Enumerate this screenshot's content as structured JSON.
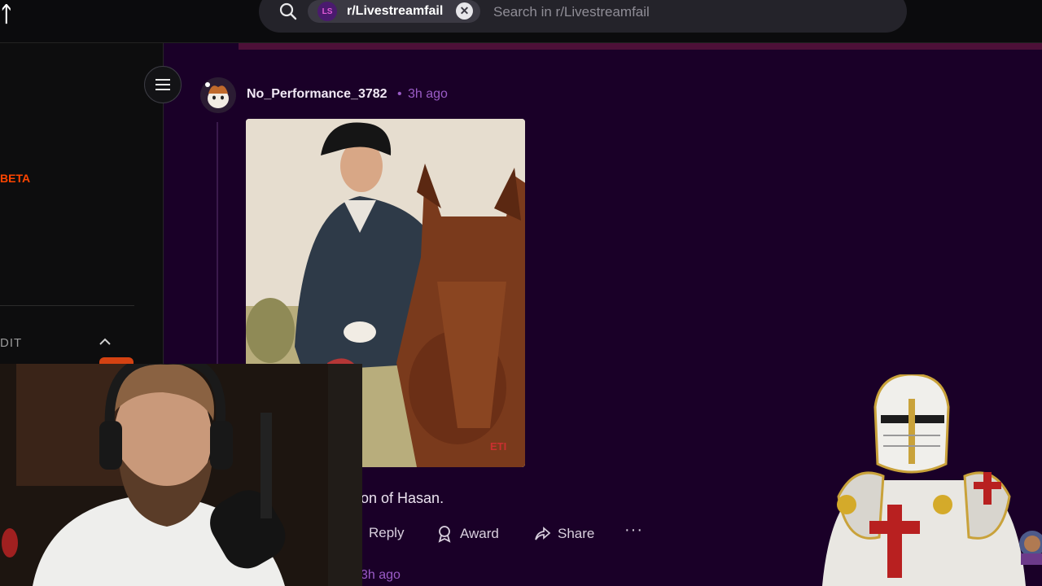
{
  "search": {
    "chip_label": "r/Livestreamfail",
    "chip_avatar_text": "LS",
    "placeholder": "Search in r/Livestreamfail",
    "clear_icon": "close-icon"
  },
  "sidebar": {
    "beta_label": "BETA",
    "section_label": "DIT",
    "menu_icon": "hamburger-icon"
  },
  "comment": {
    "username": "No_Performance_3782",
    "separator": "•",
    "time": "3h ago",
    "text": "on of Hasan.",
    "actions": {
      "reply": "Reply",
      "award": "Award",
      "share": "Share",
      "more": "···"
    }
  },
  "next_comment": {
    "time": "3h ago"
  },
  "image_caption_fragment": "ETI",
  "colors": {
    "background": "#1a0028",
    "accent_purple": "#9a5cc6",
    "beta_orange": "#ff4500"
  }
}
